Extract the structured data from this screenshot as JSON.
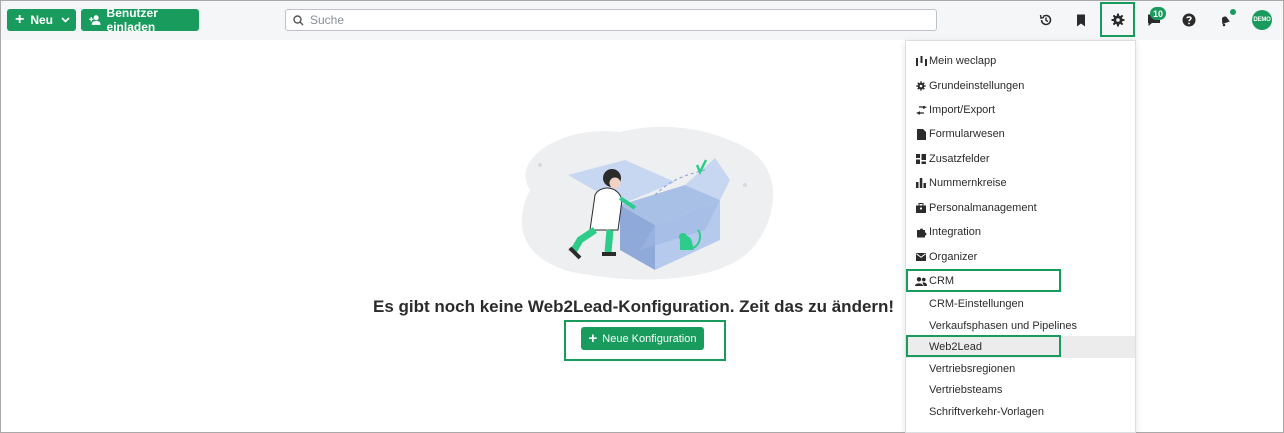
{
  "toolbar": {
    "new_label": "Neu",
    "invite_label": "Benutzer einladen",
    "search_placeholder": "Suche",
    "messages_badge": "10",
    "avatar_initials": "DEMO"
  },
  "main": {
    "empty_title": "Es gibt noch keine Web2Lead-Konfiguration. Zeit das zu ändern!",
    "cta_label": "Neue Konfiguration"
  },
  "settings_menu": {
    "items": [
      {
        "label": "Mein weclapp",
        "icon": "bar-chart-icon"
      },
      {
        "label": "Grundeinstellungen",
        "icon": "gear-icon"
      },
      {
        "label": "Import/Export",
        "icon": "swap-arrows-icon"
      },
      {
        "label": "Formularwesen",
        "icon": "document-icon"
      },
      {
        "label": "Zusatzfelder",
        "icon": "grid-icon"
      },
      {
        "label": "Nummernkreise",
        "icon": "bar-chart-icon"
      },
      {
        "label": "Personalmanagement",
        "icon": "briefcase-icon"
      },
      {
        "label": "Integration",
        "icon": "puzzle-icon"
      },
      {
        "label": "Organizer",
        "icon": "envelope-icon"
      },
      {
        "label": "CRM",
        "icon": "people-icon"
      }
    ],
    "crm_subitems": [
      {
        "label": "CRM-Einstellungen"
      },
      {
        "label": "Verkaufsphasen und Pipelines"
      },
      {
        "label": "Web2Lead",
        "active": true
      },
      {
        "label": "Vertriebsregionen"
      },
      {
        "label": "Vertriebsteams"
      },
      {
        "label": "Schriftverkehr-Vorlagen"
      }
    ]
  },
  "colors": {
    "accent": "#1a9b5e",
    "topbar_bg": "#f5f6f7",
    "active_item_bg": "#ececec"
  }
}
